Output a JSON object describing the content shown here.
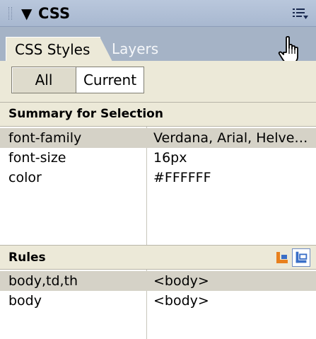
{
  "panel": {
    "title": "CSS",
    "collapse_icon": "triangle-down-icon",
    "options_icon": "options-menu-icon"
  },
  "tabs": [
    {
      "label": "CSS Styles",
      "active": true
    },
    {
      "label": "Layers",
      "active": false
    }
  ],
  "cursor_icon": "hand-pointer-icon",
  "mode_toggle": {
    "all_label": "All",
    "current_label": "Current",
    "selected": "All"
  },
  "summary": {
    "title": "Summary for Selection",
    "rows": [
      {
        "property": "font-family",
        "value": "Verdana, Arial, Helve…",
        "selected": true
      },
      {
        "property": "font-size",
        "value": "16px",
        "selected": false
      },
      {
        "property": "color",
        "value": "#FFFFFF",
        "selected": false
      }
    ]
  },
  "rules": {
    "title": "Rules",
    "icons": [
      "cascade-icon",
      "rule-tree-icon"
    ],
    "rows": [
      {
        "selector": "body,td,th",
        "source": "<body>",
        "selected": true
      },
      {
        "selector": "body",
        "source": "<body>",
        "selected": false
      }
    ]
  },
  "colors": {
    "title_bar": "#b0c0d6",
    "tab_strip": "#a5b3c6",
    "panel_bg": "#ece9d8",
    "selected_row": "#d5d2c7",
    "icon_orange": "#e8801e",
    "icon_blue": "#3a6fc7"
  }
}
